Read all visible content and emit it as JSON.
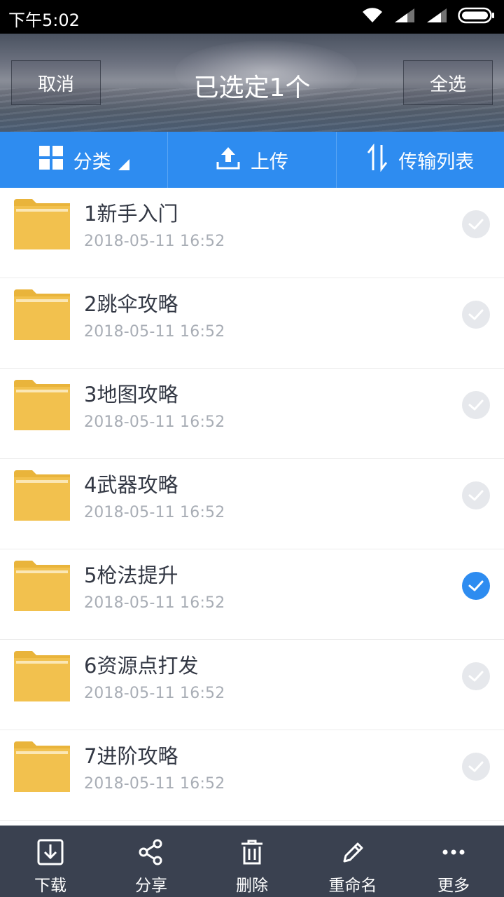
{
  "status": {
    "time": "下午5:02"
  },
  "header": {
    "cancel": "取消",
    "title": "已选定1个",
    "select_all": "全选"
  },
  "toolbar": {
    "category": "分类",
    "upload": "上传",
    "transfer_list": "传输列表"
  },
  "files": [
    {
      "name": "1新手入门",
      "date": "2018-05-11  16:52",
      "selected": false
    },
    {
      "name": "2跳伞攻略",
      "date": "2018-05-11  16:52",
      "selected": false
    },
    {
      "name": "3地图攻略",
      "date": "2018-05-11  16:52",
      "selected": false
    },
    {
      "name": "4武器攻略",
      "date": "2018-05-11  16:52",
      "selected": false
    },
    {
      "name": "5枪法提升",
      "date": "2018-05-11  16:52",
      "selected": true
    },
    {
      "name": "6资源点打发",
      "date": "2018-05-11  16:52",
      "selected": false
    },
    {
      "name": "7进阶攻略",
      "date": "2018-05-11  16:52",
      "selected": false
    }
  ],
  "bottom_bar": {
    "download": "下载",
    "share": "分享",
    "delete": "删除",
    "rename": "重命名",
    "more": "更多"
  },
  "colors": {
    "accent": "#2e8cf0",
    "folder": "#f2c14e",
    "bottom_bar": "#3a4150"
  }
}
